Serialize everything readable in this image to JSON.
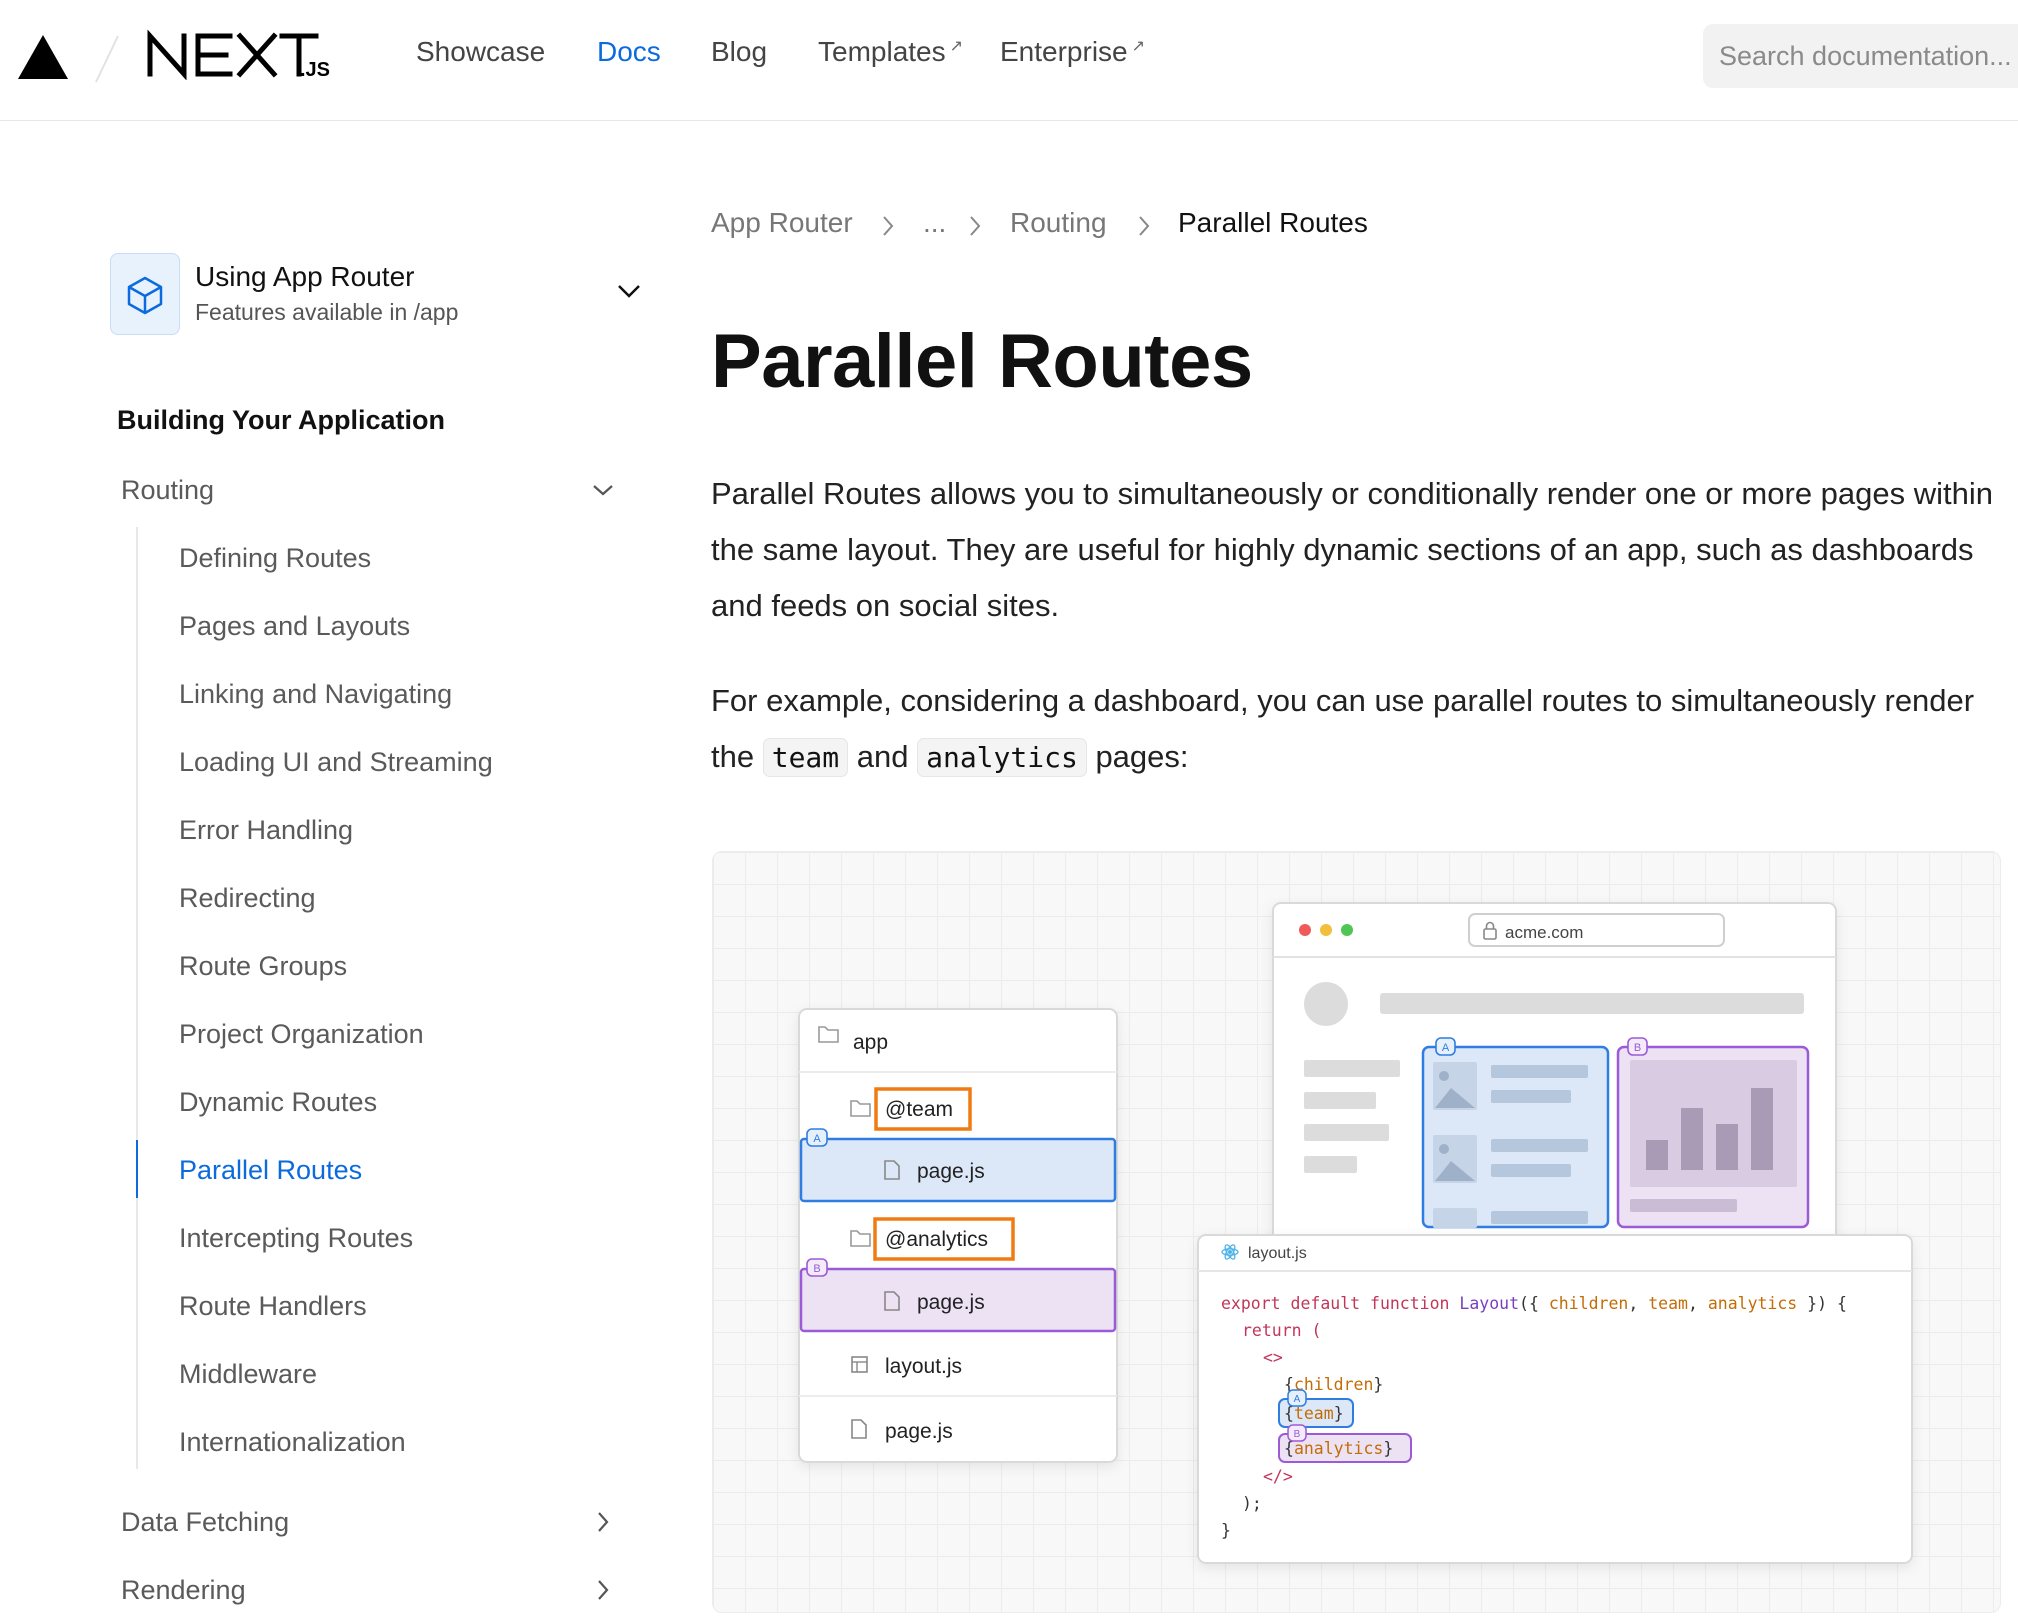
{
  "header": {
    "nav": [
      {
        "label": "Showcase",
        "active": false,
        "external": false
      },
      {
        "label": "Docs",
        "active": true,
        "external": false
      },
      {
        "label": "Blog",
        "active": false,
        "external": false
      },
      {
        "label": "Templates",
        "active": false,
        "external": true
      },
      {
        "label": "Enterprise",
        "active": false,
        "external": true
      }
    ],
    "search_placeholder": "Search documentation..."
  },
  "sidebar": {
    "version_selector": {
      "title": "Using App Router",
      "subtitle": "Features available in /app"
    },
    "section_title": "Building Your Application",
    "routing": {
      "label": "Routing"
    },
    "items": [
      "Defining Routes",
      "Pages and Layouts",
      "Linking and Navigating",
      "Loading UI and Streaming",
      "Error Handling",
      "Redirecting",
      "Route Groups",
      "Project Organization",
      "Dynamic Routes",
      "Parallel Routes",
      "Intercepting Routes",
      "Route Handlers",
      "Middleware",
      "Internationalization"
    ],
    "active_item": "Parallel Routes",
    "data_fetching": {
      "label": "Data Fetching"
    },
    "rendering": {
      "label": "Rendering"
    }
  },
  "breadcrumb": [
    "App Router",
    "...",
    "Routing",
    "Parallel Routes"
  ],
  "page": {
    "title": "Parallel Routes",
    "p1": "Parallel Routes allows you to simultaneously or conditionally render one or more pages within the same layout. They are useful for highly dynamic sections of an app, such as dashboards and feeds on social sites.",
    "p2_start": "For example, considering a dashboard, you can use parallel routes to simultaneously render the ",
    "p2_code1": "team",
    "p2_mid": " and ",
    "p2_code2": "analytics",
    "p2_end": " pages:"
  },
  "illustration": {
    "tree": {
      "root": "app",
      "team_folder": "@team",
      "team_page": "page.js",
      "analytics_folder": "@analytics",
      "analytics_page": "page.js",
      "layout": "layout.js",
      "page": "page.js"
    },
    "slot_a": "A",
    "slot_b": "B",
    "browser_url": "acme.com",
    "code_filename": "layout.js",
    "code": {
      "l1_kw": "export default function",
      "l1_fn": "Layout",
      "l1_open": "({ ",
      "l1_p1": "children",
      "l1_p2": "team",
      "l1_p3": "analytics",
      "l1_close": " }) {",
      "l2": "return (",
      "l3": "<>",
      "l4": "children",
      "l5": "team",
      "l6": "analytics",
      "l7": "</>",
      "l8": ");",
      "l9": "}"
    },
    "colors": {
      "slot_a": "#2f7de1",
      "slot_b": "#9b5bd6",
      "highlight": "#f07b12"
    }
  }
}
